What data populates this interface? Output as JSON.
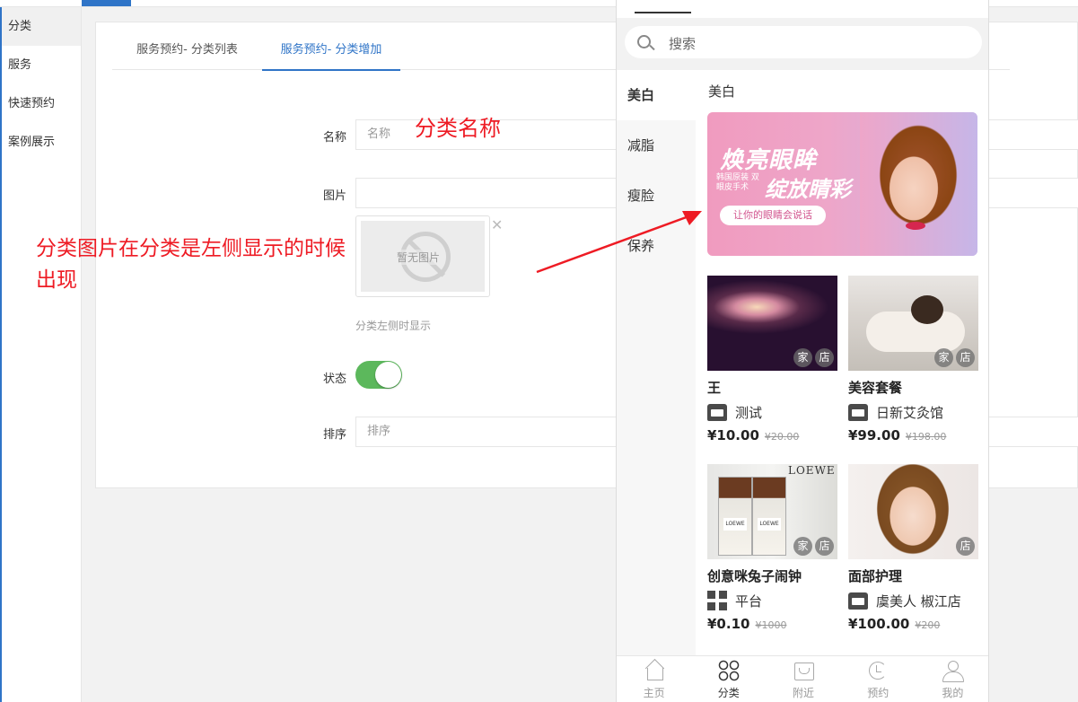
{
  "sidebar": {
    "items": [
      {
        "label": "分类",
        "active": true
      },
      {
        "label": "服务",
        "active": false
      },
      {
        "label": "快速预约",
        "active": false
      },
      {
        "label": "案例展示",
        "active": false
      }
    ]
  },
  "tabs": [
    {
      "label": "服务预约- 分类列表",
      "active": false
    },
    {
      "label": "服务预约- 分类增加",
      "active": true
    }
  ],
  "form": {
    "name_label": "名称",
    "name_placeholder": "名称",
    "image_label": "图片",
    "no_image_text": "暂无图片",
    "image_hint": "分类左侧时显示",
    "status_label": "状态",
    "status_on": true,
    "sort_label": "排序",
    "sort_placeholder": "排序"
  },
  "annotations": {
    "category_name": "分类名称",
    "category_image_note_line1": "分类图片在分类是左侧显示的时候",
    "category_image_note_line2": "出现",
    "color": "#ee1b24"
  },
  "phone": {
    "search_placeholder": "搜索",
    "categories": [
      {
        "label": "美白",
        "active": true
      },
      {
        "label": "减脂",
        "active": false
      },
      {
        "label": "瘦脸",
        "active": false
      },
      {
        "label": "保养",
        "active": false
      }
    ],
    "current_category": "美白",
    "banner": {
      "title": "焕亮眼眸",
      "subtitle": "韩国原装 双眼皮手术",
      "title2": "绽放睛彩",
      "pill": "让你的眼睛会说话"
    },
    "products": [
      {
        "name": "王",
        "shop": "测试",
        "shop_icon": "store-icon",
        "price": "¥10.00",
        "original_price": "¥20.00",
        "badges": [
          "家",
          "店"
        ]
      },
      {
        "name": "美容套餐",
        "shop": "日新艾灸馆",
        "shop_icon": "store-icon",
        "price": "¥99.00",
        "original_price": "¥198.00",
        "badges": [
          "家",
          "店"
        ]
      },
      {
        "name": "创意咪兔子闹钟",
        "shop": "平台",
        "shop_icon": "grid-icon",
        "price": "¥0.10",
        "original_price": "¥1000",
        "badges": [
          "家",
          "店"
        ],
        "image_brand": "LOEWE"
      },
      {
        "name": "面部护理",
        "shop": "虞美人 椒江店",
        "shop_icon": "store-icon",
        "price": "¥100.00",
        "original_price": "¥200",
        "badges": [
          "店"
        ]
      }
    ],
    "bottom_nav": [
      {
        "label": "主页",
        "icon": "home-icon",
        "active": false
      },
      {
        "label": "分类",
        "icon": "category-icon",
        "active": true
      },
      {
        "label": "附近",
        "icon": "nearby-icon",
        "active": false
      },
      {
        "label": "预约",
        "icon": "booking-icon",
        "active": false
      },
      {
        "label": "我的",
        "icon": "profile-icon",
        "active": false
      }
    ]
  }
}
